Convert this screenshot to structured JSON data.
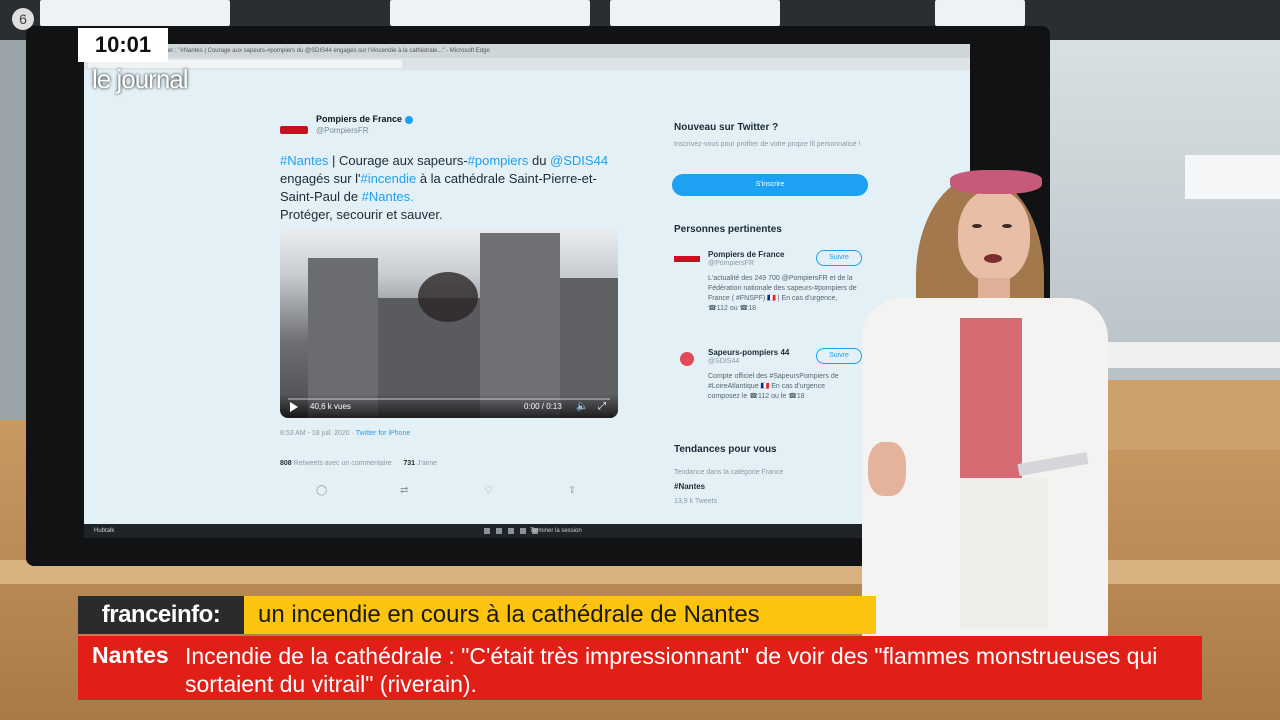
{
  "overlay": {
    "clock": "10:01",
    "show_name": "le journal"
  },
  "screen": {
    "browser_title": "Pompiers de France sur Twitter : \"#Nantes | Courage aux sapeurs-#pompiers du @SDIS44 engagés sur l'#incendie à la cathédrale...\" - Microsoft Edge",
    "taskbar_label": "Hubtalk",
    "taskbar_action": "Terminer la session",
    "tweet": {
      "account_name": "Pompiers de France",
      "account_handle": "@PompiersFR",
      "text_segments": [
        {
          "text": "#Nantes",
          "link": true
        },
        {
          "text": " | Courage aux sapeurs-",
          "link": false
        },
        {
          "text": "#pompiers",
          "link": true
        },
        {
          "text": " du ",
          "link": false
        },
        {
          "text": "@SDIS44",
          "link": true
        },
        {
          "text": " engagés sur l'",
          "link": false
        },
        {
          "text": "#incendie",
          "link": true
        },
        {
          "text": " à la cathédrale Saint-Pierre-et-Saint-Paul de ",
          "link": false
        },
        {
          "text": "#Nantes.",
          "link": true
        }
      ],
      "text_line2": "Protéger, secourir et sauver.",
      "video": {
        "views": "40,6 k vues",
        "time": "0:00 / 0:13"
      },
      "timestamp": "8:53 AM - 18 juil. 2020",
      "source": "Twitter for iPhone",
      "retweets_count": "808",
      "retweets_label": "Retweets avec un commentaire",
      "likes_count": "731",
      "likes_label": "J'aime"
    },
    "sidebar": {
      "new_title": "Nouveau sur Twitter ?",
      "new_sub": "Inscrivez-vous pour profiter de votre propre fil personnalisé !",
      "signup_label": "S'inscrire",
      "relevant_title": "Personnes pertinentes",
      "people": [
        {
          "name": "Pompiers de France",
          "handle": "@PompiersFR",
          "follow": "Suivre",
          "bio": "L'actualité des 249 700 @PompiersFR et de la Fédération nationale des sapeurs-#pompiers de France ( #FNSPF) 🇫🇷 | En cas d'urgence, ☎112 ou ☎18"
        },
        {
          "name": "Sapeurs-pompiers 44",
          "handle": "@SDIS44",
          "follow": "Suivre",
          "bio": "Compte officiel des #SapeursPompiers de #LoireAtlantique 🇫🇷 En cas d'urgence composez le ☎112 ou le ☎18"
        }
      ],
      "trends_title": "Tendances pour vous",
      "trend_context": "Tendance dans la catégorie France",
      "trend_tag": "#Nantes",
      "trend_count": "13,9 k Tweets"
    }
  },
  "lower_third": {
    "brand": "franceinfo:",
    "headline": "un incendie en cours à la cathédrale de Nantes",
    "ticker_label": "Nantes",
    "ticker_text": "Incendie de la cathédrale : \"C'était très impressionnant\" de voir des \"flammes monstrueuses qui sortaient du vitrail\" (riverain)."
  },
  "colors": {
    "twitter_blue": "#1da1f2",
    "headline_yellow": "#fcc40f",
    "ticker_red": "#e21f17",
    "brand_dark": "#2b2b2b"
  }
}
